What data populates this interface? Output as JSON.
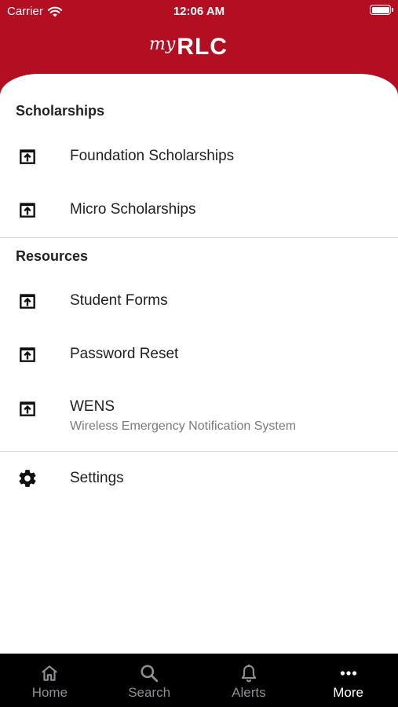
{
  "status_bar": {
    "carrier": "Carrier",
    "time": "12:06 AM"
  },
  "header": {
    "logo_my": "my",
    "logo_main": "RLC"
  },
  "sections": [
    {
      "title": "Scholarships",
      "items": [
        {
          "label": "Foundation Scholarships",
          "icon": "open-in-app-icon"
        },
        {
          "label": "Micro Scholarships",
          "icon": "open-in-app-icon"
        }
      ]
    },
    {
      "title": "Resources",
      "items": [
        {
          "label": "Student Forms",
          "icon": "open-in-app-icon"
        },
        {
          "label": "Password Reset",
          "icon": "open-in-app-icon"
        },
        {
          "label": "WENS",
          "sublabel": "Wireless Emergency Notification System",
          "icon": "open-in-app-icon"
        }
      ]
    }
  ],
  "settings": {
    "label": "Settings",
    "icon": "gear-icon"
  },
  "tabbar": {
    "tabs": [
      {
        "label": "Home",
        "icon": "home-icon",
        "active": false
      },
      {
        "label": "Search",
        "icon": "search-icon",
        "active": false
      },
      {
        "label": "Alerts",
        "icon": "bell-icon",
        "active": false
      },
      {
        "label": "More",
        "icon": "more-dots-icon",
        "active": true
      }
    ]
  },
  "colors": {
    "brand": "#b30e22",
    "tabbar": "#000000",
    "tab_inactive": "#8e8e93",
    "tab_active": "#ffffff"
  }
}
